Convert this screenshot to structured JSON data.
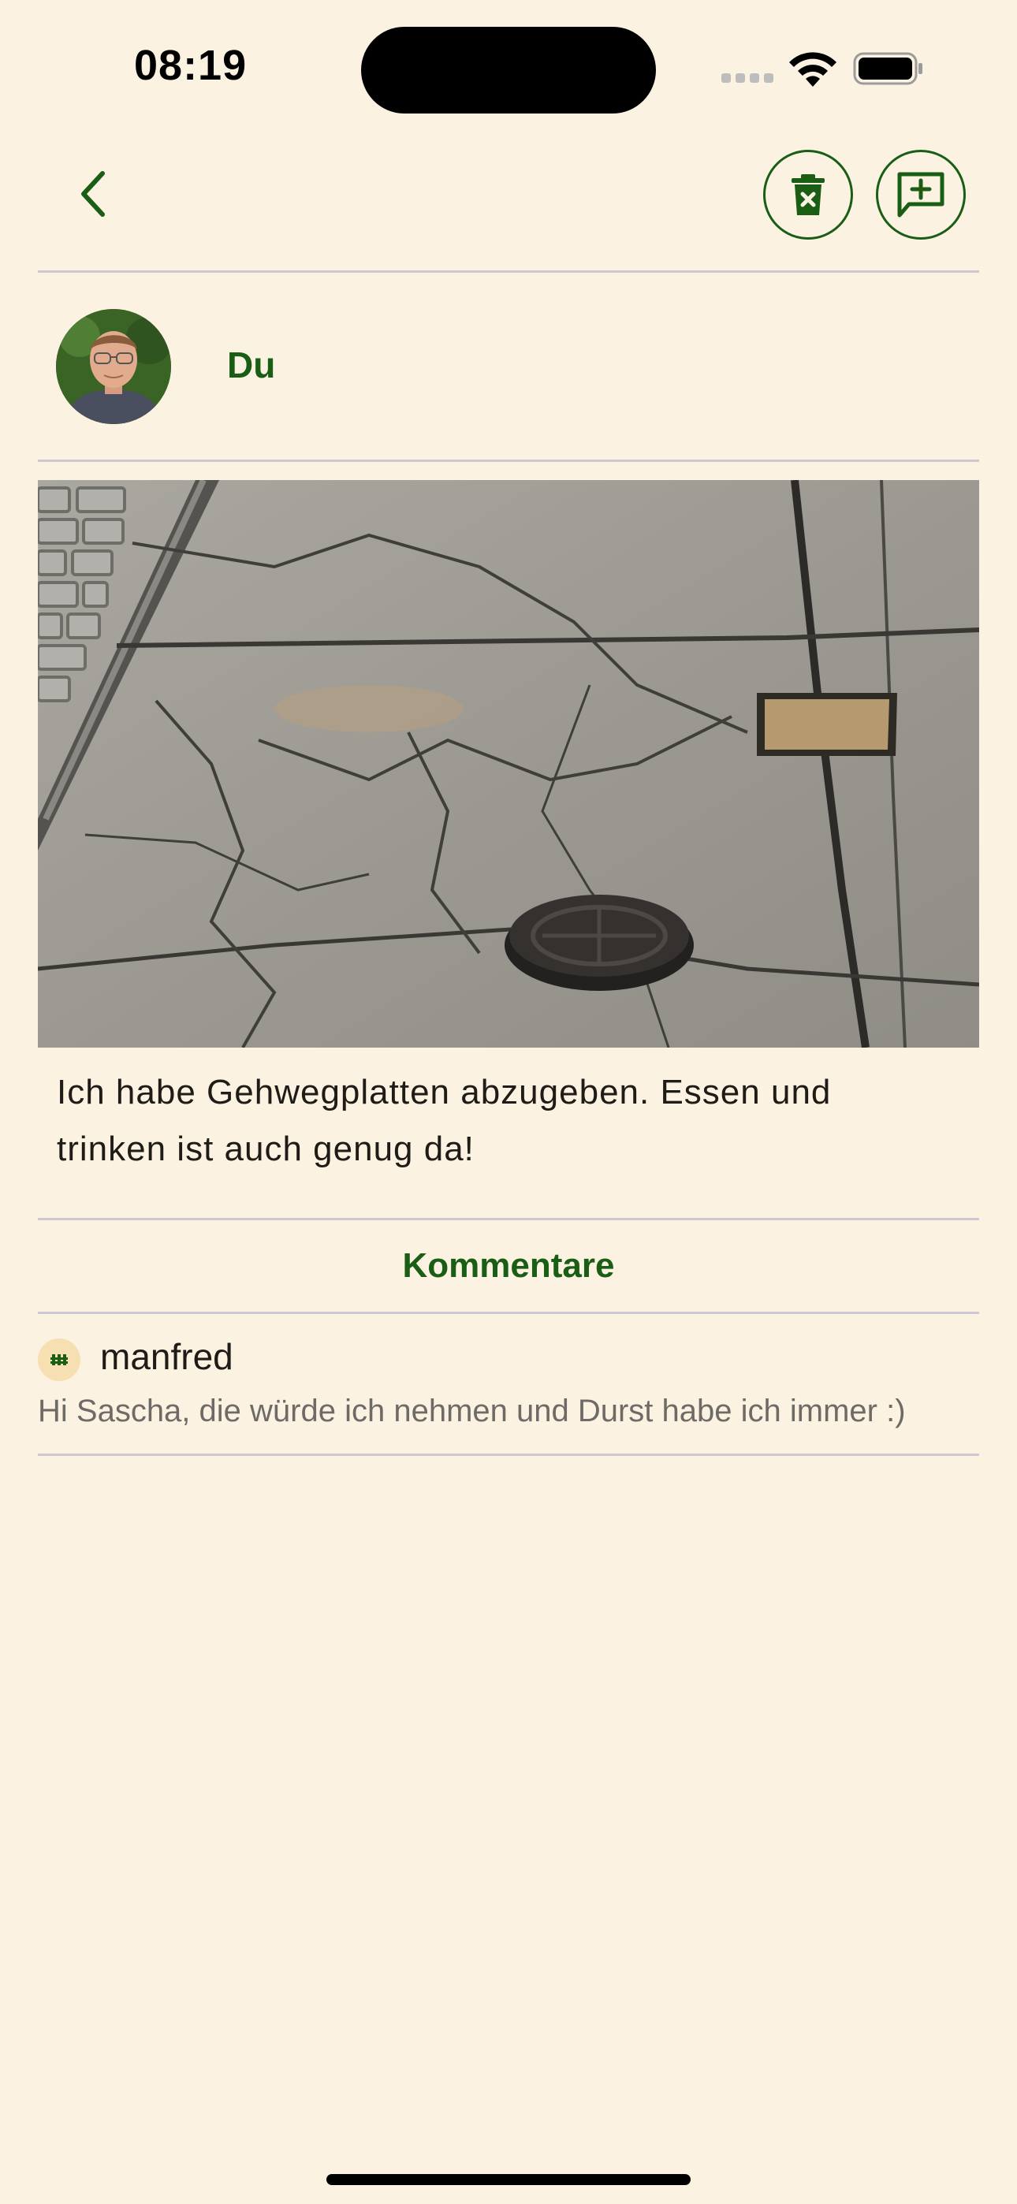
{
  "status_bar": {
    "time": "08:19"
  },
  "toolbar": {
    "back_icon": "chevron-left-icon",
    "delete_icon": "delete-icon",
    "add_comment_icon": "add-comment-icon"
  },
  "author": {
    "name": "Du"
  },
  "post": {
    "text": "Ich habe Gehwegplatten abzugeben. Essen und trinken ist auch genug da!"
  },
  "comments": {
    "title": "Kommentare",
    "items": [
      {
        "author": "manfred",
        "text": "Hi Sascha, die würde ich nehmen und Durst habe ich immer :)"
      }
    ]
  },
  "colors": {
    "background": "#FBF2E2",
    "accent": "#1A5E16",
    "divider": "#CFC7D3",
    "comment_text": "#6E6A66"
  }
}
